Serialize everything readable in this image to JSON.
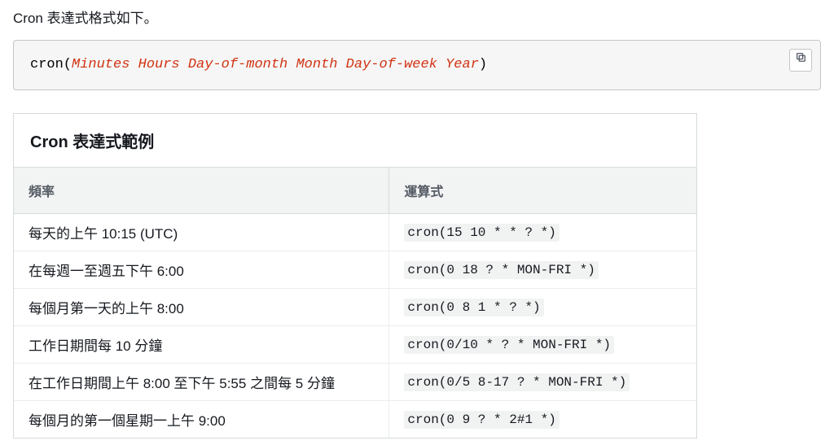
{
  "intro": "Cron 表達式格式如下。",
  "codeblock": {
    "prefix": "cron(",
    "replaceable": "Minutes Hours Day-of-month Month Day-of-week Year",
    "suffix": ")"
  },
  "copy_label": "Copy",
  "table": {
    "title": "Cron 表達式範例",
    "headers": {
      "frequency": "頻率",
      "expression": "運算式"
    },
    "rows": [
      {
        "frequency": "每天的上午 10:15 (UTC)",
        "expression": "cron(15 10 * * ? *)"
      },
      {
        "frequency": "在每週一至週五下午 6:00",
        "expression": "cron(0 18 ? * MON-FRI *)"
      },
      {
        "frequency": "每個月第一天的上午 8:00",
        "expression": "cron(0 8 1 * ? *)"
      },
      {
        "frequency": "工作日期間每 10 分鐘",
        "expression": "cron(0/10 * ? * MON-FRI *)"
      },
      {
        "frequency": "在工作日期間上午 8:00 至下午 5:55 之間每 5 分鐘",
        "expression": "cron(0/5 8-17 ? * MON-FRI *)"
      },
      {
        "frequency": "每個月的第一個星期一上午 9:00",
        "expression": "cron(0 9 ? * 2#1 *)"
      }
    ]
  }
}
